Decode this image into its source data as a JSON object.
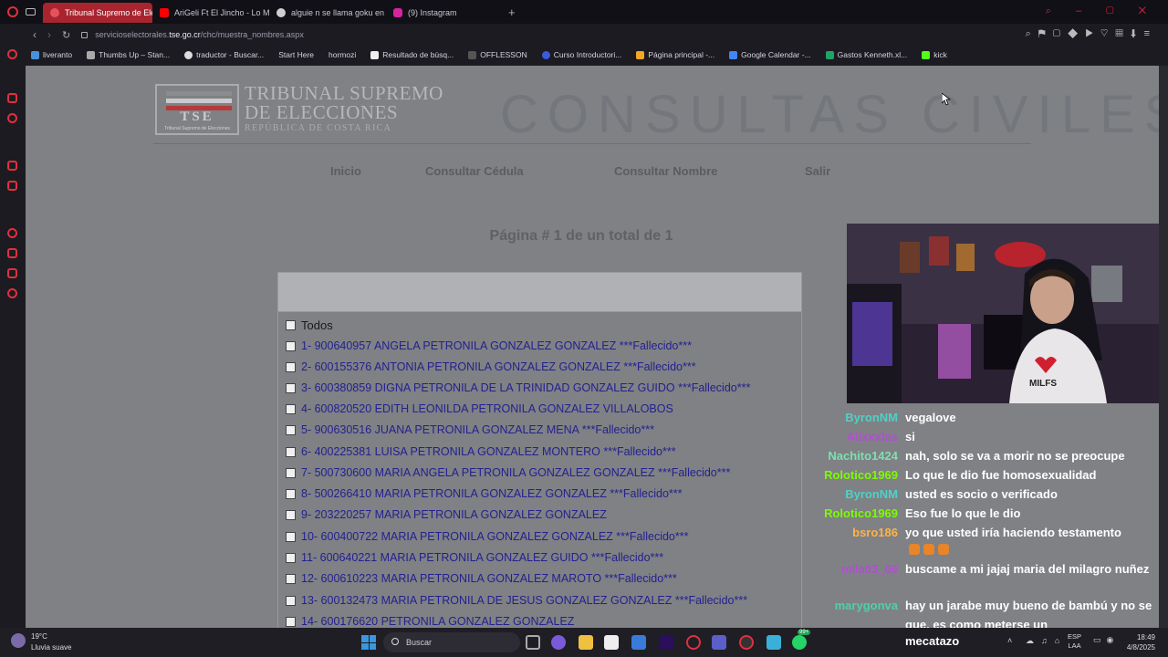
{
  "browser": {
    "tabs": [
      {
        "label": "Tribunal Supremo de Elec",
        "active": true,
        "color": "#e8515b"
      },
      {
        "label": "AriGeli Ft El Jincho - Lo M",
        "active": false,
        "color": "#ff0000"
      },
      {
        "label": "alguie n se llama goku en",
        "active": false,
        "color": "#cfcfcf"
      },
      {
        "label": "(9) Instagram",
        "active": false,
        "color": "#d6249f"
      }
    ],
    "url_prefix": "servicioselectorales.",
    "url_domain": "tse.go.cr",
    "url_path": "/chc/muestra_nombres.aspx",
    "bookmarks": [
      {
        "label": "liveranto",
        "color": "#4a90d9"
      },
      {
        "label": "Thumbs Up – Stan...",
        "color": "#aaaaaa"
      },
      {
        "label": "traductor - Buscar...",
        "color": "#dddddd"
      },
      {
        "label": "Start Here",
        "color": "#1c1b22"
      },
      {
        "label": "hormozi",
        "color": "#1c1b22"
      },
      {
        "label": "Resultado de búsq...",
        "color": "#eeeeee"
      },
      {
        "label": "OFFLESSON",
        "color": "#333333"
      },
      {
        "label": "Curso Introductori...",
        "color": "#3b5bdb"
      },
      {
        "label": "Página principal -...",
        "color": "#f5a623"
      },
      {
        "label": "Google Calendar -...",
        "color": "#4285f4"
      },
      {
        "label": "Gastos Kenneth.xl...",
        "color": "#21a366"
      },
      {
        "label": "kick",
        "color": "#53fc18"
      }
    ]
  },
  "page": {
    "org_line1": "TRIBUNAL SUPREMO",
    "org_line2": "DE ELECCIONES",
    "org_sub": "REPÚBLICA DE COSTA RICA",
    "logo_caption": "Tribunal Supremo de Elecciones",
    "logo_text": "TSE",
    "heading": "CONSULTAS CIVILES",
    "nav": {
      "inicio": "Inicio",
      "cedula": "Consultar Cédula",
      "nombre": "Consultar Nombre",
      "salir": "Salir"
    },
    "page_count": "Página # 1 de un total de 1",
    "select_all": "Todos",
    "results": [
      "1- 900640957 ANGELA PETRONILA GONZALEZ GONZALEZ ***Fallecido***",
      "2- 600155376 ANTONIA PETRONILA GONZALEZ GONZALEZ ***Fallecido***",
      "3- 600380859 DIGNA PETRONILA DE LA TRINIDAD GONZALEZ GUIDO ***Fallecido***",
      "4- 600820520 EDITH LEONILDA PETRONILA GONZALEZ VILLALOBOS",
      "5- 900630516 JUANA PETRONILA GONZALEZ MENA ***Fallecido***",
      "6- 400225381 LUISA PETRONILA GONZALEZ MONTERO ***Fallecido***",
      "7- 500730600 MARIA ANGELA PETRONILA GONZALEZ GONZALEZ ***Fallecido***",
      "8- 500266410 MARIA PETRONILA GONZALEZ GONZALEZ ***Fallecido***",
      "9- 203220257 MARIA PETRONILA GONZALEZ GONZALEZ",
      "10- 600400722 MARIA PETRONILA GONZALEZ GONZALEZ ***Fallecido***",
      "11- 600640221 MARIA PETRONILA GONZALEZ GUIDO ***Fallecido***",
      "12- 600610223 MARIA PETRONILA GONZALEZ MAROTO ***Fallecido***",
      "13- 600132473 MARIA PETRONILA DE JESUS GONZALEZ GONZALEZ ***Fallecido***",
      "14- 600176620 PETRONILA GONZALEZ GONZALEZ"
    ]
  },
  "stream": {
    "shirt_text": "MILFS",
    "chat": [
      {
        "user": "ByronNM",
        "color": "#4fd1c5",
        "msg": "vegalove"
      },
      {
        "user": "Alixxxlas",
        "color": "#b04fd1",
        "msg": "si"
      },
      {
        "user": "Nachito1424",
        "color": "#7ee0b0",
        "msg": "nah, solo se va a morir no se preocupe"
      },
      {
        "user": "Rolotico1969",
        "color": "#7cfc00",
        "msg": "Lo que le dio fue homosexualidad"
      },
      {
        "user": "ByronNM",
        "color": "#4fd1c5",
        "msg": "usted es socio o verificado"
      },
      {
        "user": "Rolotico1969",
        "color": "#7cfc00",
        "msg": "Eso fue lo que le dio"
      },
      {
        "user": "bsro186",
        "color": "#ffb347",
        "msg": "yo que usted iría haciendo testamento"
      },
      {
        "user": "mila03_06",
        "color": "#b04fd1",
        "msg": "buscame a mi jajaj maria del milagro nuñez"
      },
      {
        "user": "marygonva",
        "color": "#4fd1a5",
        "msg": "hay un jarabe muy bueno de bambú y no se que, es como meterse un"
      }
    ],
    "bottom_word": "mecatazo"
  },
  "taskbar": {
    "weather_temp": "19°C",
    "weather_desc": "Lluvia suave",
    "search_placeholder": "Buscar",
    "lang": "ESP",
    "lang2": "LAA",
    "time": "18:49",
    "date": "4/8/2025",
    "badge": "99+"
  }
}
